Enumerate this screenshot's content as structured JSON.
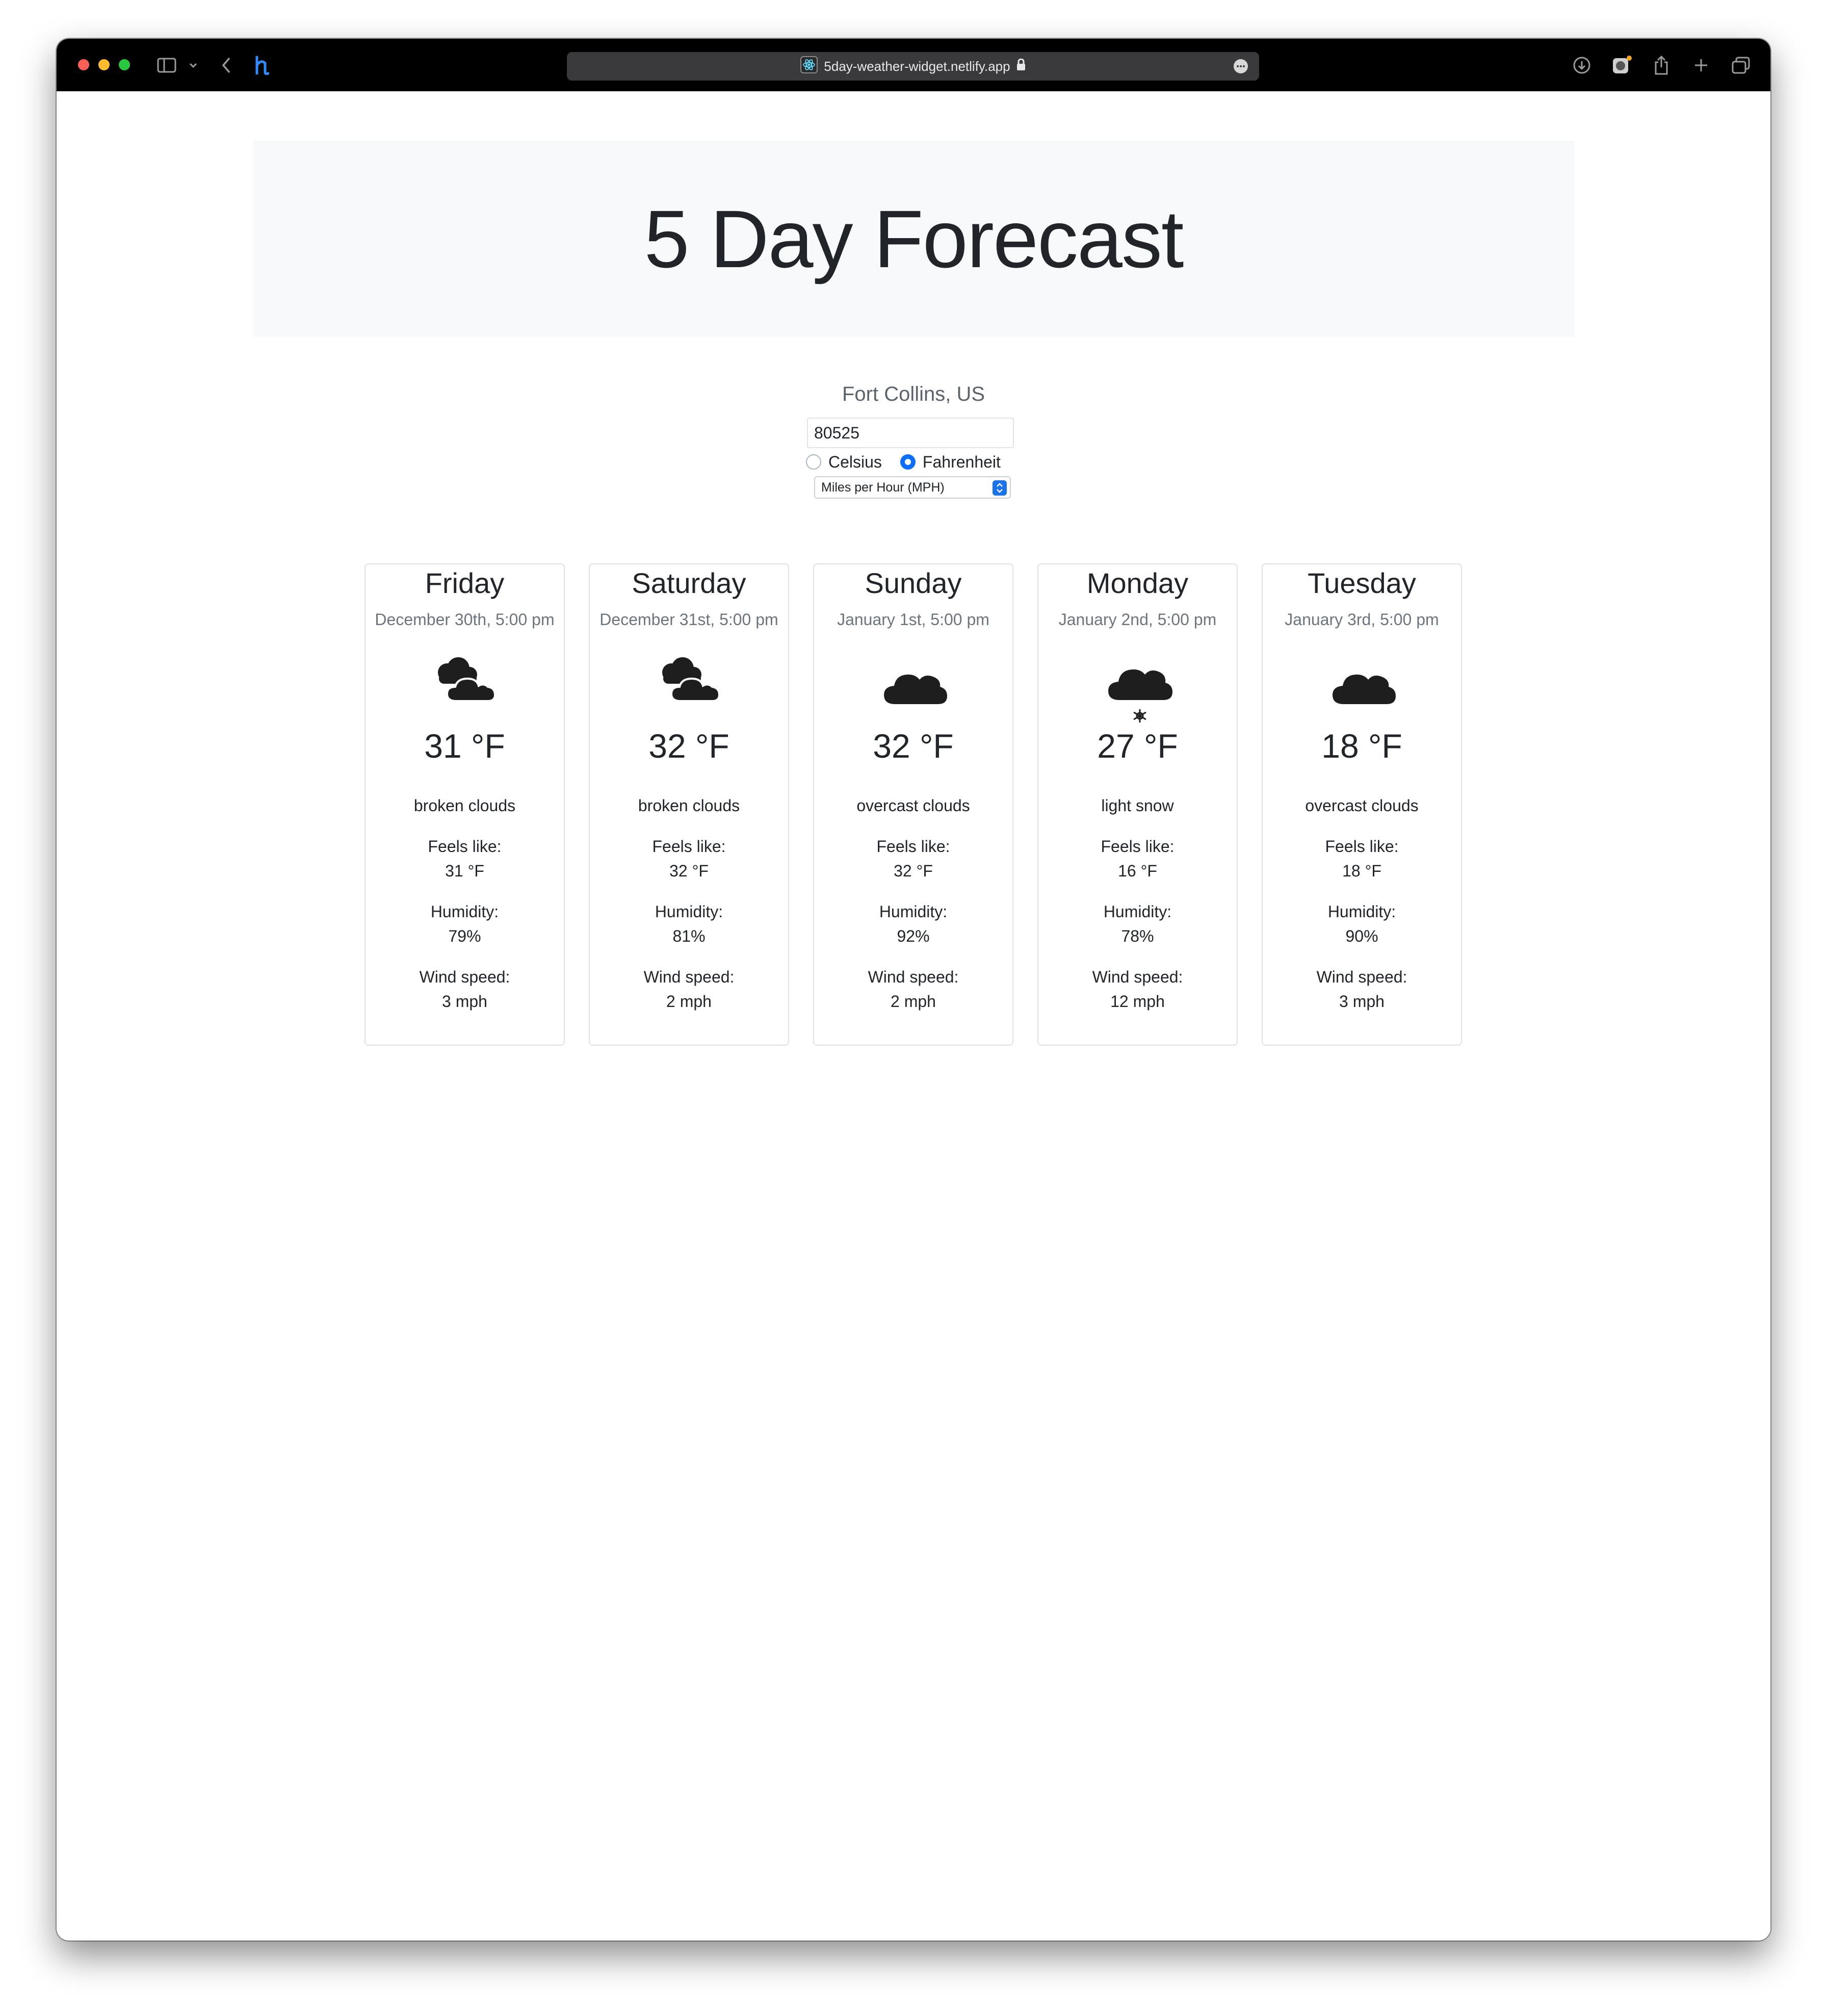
{
  "browser": {
    "url": "5day-weather-widget.netlify.app"
  },
  "page": {
    "title": "5 Day Forecast",
    "location": "Fort Collins, US",
    "zip_value": "80525",
    "unit_options": [
      "Celsius",
      "Fahrenheit"
    ],
    "unit_selected": "Fahrenheit",
    "wind_unit": "Miles per Hour (MPH)"
  },
  "forecast": [
    {
      "day": "Friday",
      "date": "December 30th, 5:00 pm",
      "icon": "broken-clouds-icon",
      "temp": "31 °F",
      "desc": "broken clouds",
      "feels_label": "Feels like:",
      "feels": "31 °F",
      "hum_label": "Humidity:",
      "humidity": "79%",
      "wind_label": "Wind speed:",
      "wind": "3 mph"
    },
    {
      "day": "Saturday",
      "date": "December 31st, 5:00 pm",
      "icon": "broken-clouds-icon",
      "temp": "32 °F",
      "desc": "broken clouds",
      "feels_label": "Feels like:",
      "feels": "32 °F",
      "hum_label": "Humidity:",
      "humidity": "81%",
      "wind_label": "Wind speed:",
      "wind": "2 mph"
    },
    {
      "day": "Sunday",
      "date": "January 1st, 5:00 pm",
      "icon": "overcast-clouds-icon",
      "temp": "32 °F",
      "desc": "overcast clouds",
      "feels_label": "Feels like:",
      "feels": "32 °F",
      "hum_label": "Humidity:",
      "humidity": "92%",
      "wind_label": "Wind speed:",
      "wind": "2 mph"
    },
    {
      "day": "Monday",
      "date": "January 2nd, 5:00 pm",
      "icon": "light-snow-icon",
      "temp": "27 °F",
      "desc": "light snow",
      "feels_label": "Feels like:",
      "feels": "16 °F",
      "hum_label": "Humidity:",
      "humidity": "78%",
      "wind_label": "Wind speed:",
      "wind": "12 mph"
    },
    {
      "day": "Tuesday",
      "date": "January 3rd, 5:00 pm",
      "icon": "overcast-clouds-icon",
      "temp": "18 °F",
      "desc": "overcast clouds",
      "feels_label": "Feels like:",
      "feels": "18 °F",
      "hum_label": "Humidity:",
      "humidity": "90%",
      "wind_label": "Wind speed:",
      "wind": "3 mph"
    }
  ],
  "colors": {
    "accent": "#0d6efd",
    "jumbotron_bg": "#f8f9fa",
    "icon_dark": "#1e1e1e"
  }
}
